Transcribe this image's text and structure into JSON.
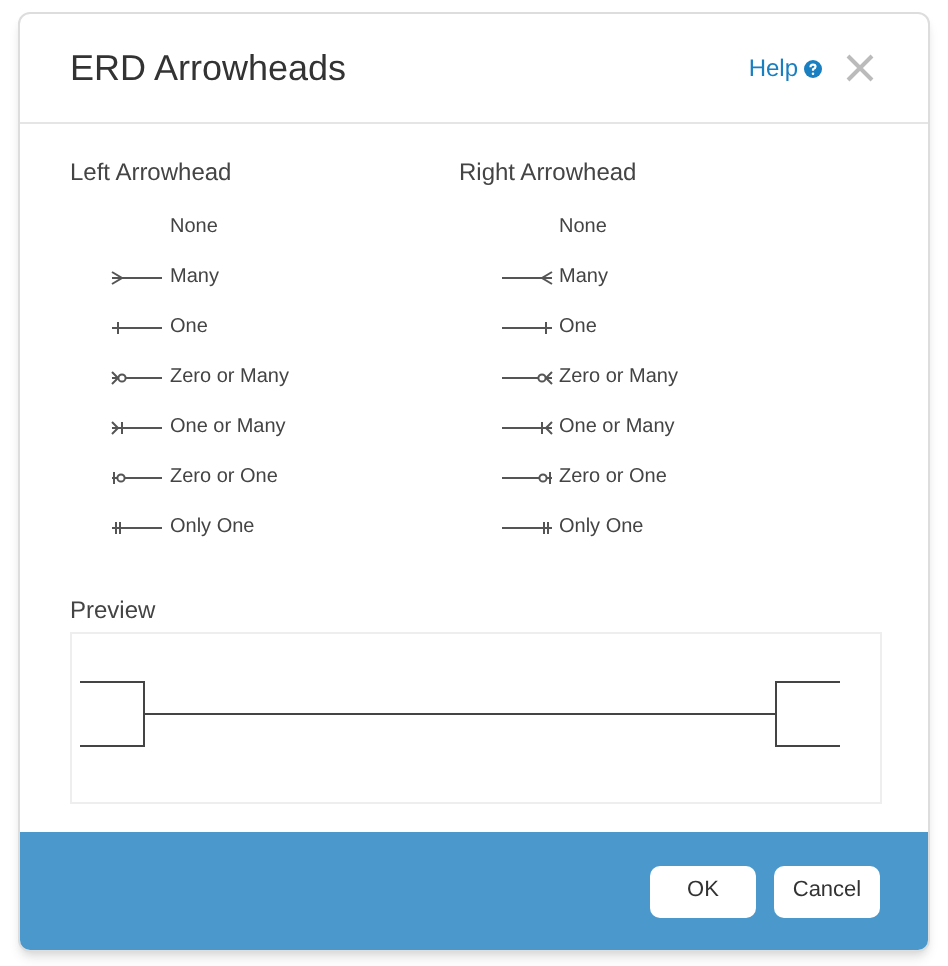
{
  "dialog": {
    "title": "ERD Arrowheads",
    "help": "Help"
  },
  "left": {
    "heading": "Left Arrowhead",
    "options": [
      {
        "label": "None",
        "kind": "none"
      },
      {
        "label": "Many",
        "kind": "many"
      },
      {
        "label": "One",
        "kind": "one"
      },
      {
        "label": "Zero or Many",
        "kind": "zero_many"
      },
      {
        "label": "One or Many",
        "kind": "one_many"
      },
      {
        "label": "Zero or One",
        "kind": "zero_one"
      },
      {
        "label": "Only One",
        "kind": "only_one"
      }
    ]
  },
  "right": {
    "heading": "Right Arrowhead",
    "options": [
      {
        "label": "None",
        "kind": "none"
      },
      {
        "label": "Many",
        "kind": "many"
      },
      {
        "label": "One",
        "kind": "one"
      },
      {
        "label": "Zero or Many",
        "kind": "zero_many"
      },
      {
        "label": "One or Many",
        "kind": "one_many"
      },
      {
        "label": "Zero or One",
        "kind": "zero_one"
      },
      {
        "label": "Only One",
        "kind": "only_one"
      }
    ]
  },
  "preview": {
    "label": "Preview"
  },
  "buttons": [
    "OK",
    "Cancel"
  ]
}
